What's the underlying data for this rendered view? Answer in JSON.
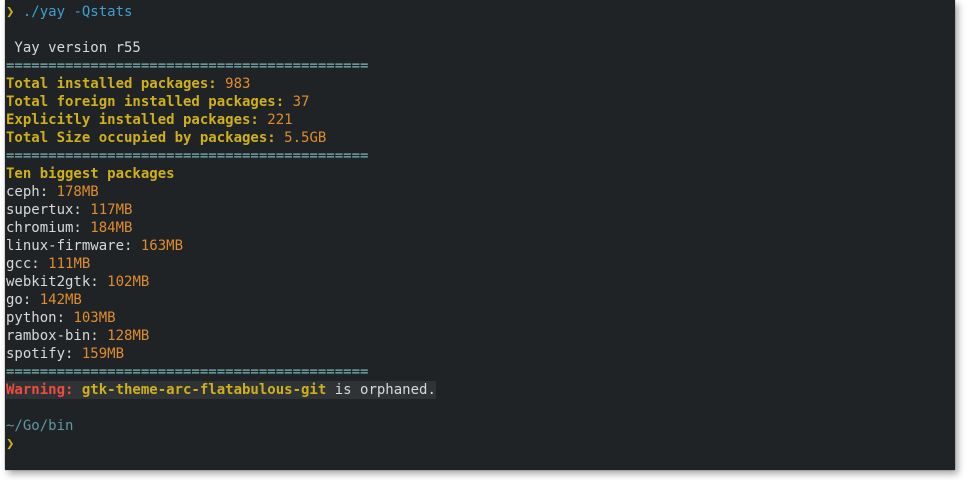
{
  "prompt": {
    "arrow": "❯",
    "command": "./yay -Qstats"
  },
  "version_line": " Yay version r55",
  "separator": "===========================================",
  "stats": [
    {
      "label": "Total installed packages: ",
      "value": "983"
    },
    {
      "label": "Total foreign installed packages: ",
      "value": "37"
    },
    {
      "label": "Explicitly installed packages: ",
      "value": "221"
    },
    {
      "label": "Total Size occupied by packages: ",
      "value": "5.5GB"
    }
  ],
  "biggest_heading": "Ten biggest packages",
  "packages": [
    {
      "name": "ceph: ",
      "size": "178MB"
    },
    {
      "name": "supertux: ",
      "size": "117MB"
    },
    {
      "name": "chromium: ",
      "size": "184MB"
    },
    {
      "name": "linux-firmware: ",
      "size": "163MB"
    },
    {
      "name": "gcc: ",
      "size": "111MB"
    },
    {
      "name": "webkit2gtk: ",
      "size": "102MB"
    },
    {
      "name": "go: ",
      "size": "142MB"
    },
    {
      "name": "python: ",
      "size": "103MB"
    },
    {
      "name": "rambox-bin: ",
      "size": "128MB"
    },
    {
      "name": "spotify: ",
      "size": "159MB"
    }
  ],
  "warning": {
    "label": "Warning: ",
    "package": "gtk-theme-arc-flatabulous-git",
    "message": " is orphaned."
  },
  "cwd": "~/Go/bin",
  "next_prompt": "❯"
}
